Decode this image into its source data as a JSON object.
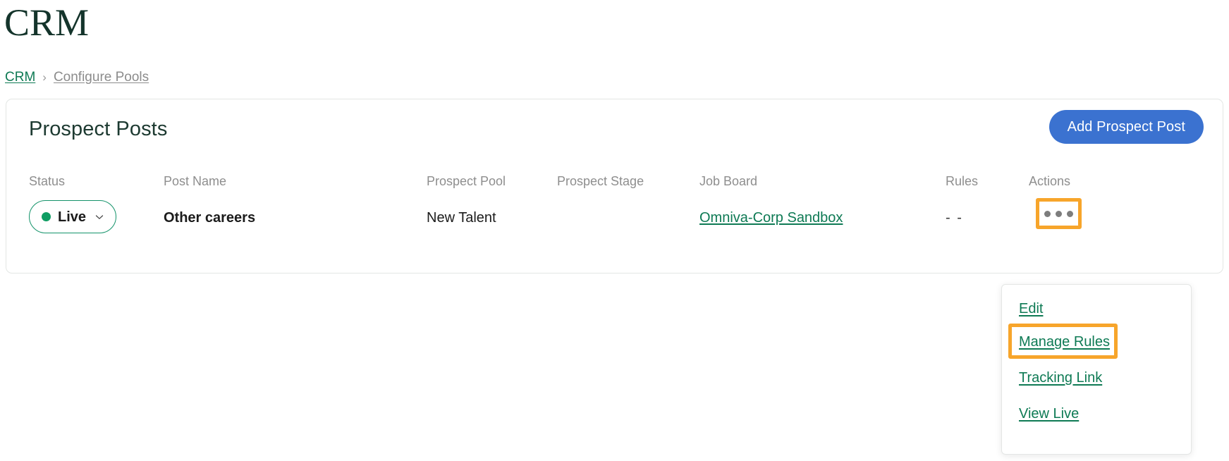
{
  "page": {
    "title": "CRM"
  },
  "breadcrumb": {
    "root_label": "CRM",
    "separator": "›",
    "current_label": "Configure Pools"
  },
  "card": {
    "title": "Prospect Posts",
    "add_button_label": "Add Prospect Post"
  },
  "table": {
    "columns": [
      {
        "key": "status",
        "label": "Status"
      },
      {
        "key": "post_name",
        "label": "Post Name"
      },
      {
        "key": "prospect_pool",
        "label": "Prospect Pool"
      },
      {
        "key": "prospect_stage",
        "label": "Prospect Stage"
      },
      {
        "key": "job_board",
        "label": "Job Board"
      },
      {
        "key": "rules",
        "label": "Rules"
      },
      {
        "key": "actions",
        "label": "Actions"
      }
    ],
    "rows": [
      {
        "status": "Live",
        "status_chevron_icon": "chevron-down-icon",
        "post_name": "Other careers",
        "prospect_pool": "New Talent",
        "prospect_stage": "",
        "job_board": "Omniva-Corp Sandbox",
        "rules": "- -",
        "actions_icon": "kebab-menu-icon"
      }
    ]
  },
  "actions_menu": {
    "items": [
      {
        "label": "Edit"
      },
      {
        "label": "Manage Rules"
      },
      {
        "label": "Tracking Link"
      },
      {
        "label": "View Live"
      }
    ],
    "highlighted_item": "Manage Rules"
  },
  "colors": {
    "title_green": "#14342b",
    "link_green": "#0e7a54",
    "status_green": "#0f9d63",
    "primary_blue": "#3b72d0",
    "highlight_orange": "#f7a52b",
    "muted_gray": "#8e8e8e",
    "card_border": "#e3e6e4"
  }
}
